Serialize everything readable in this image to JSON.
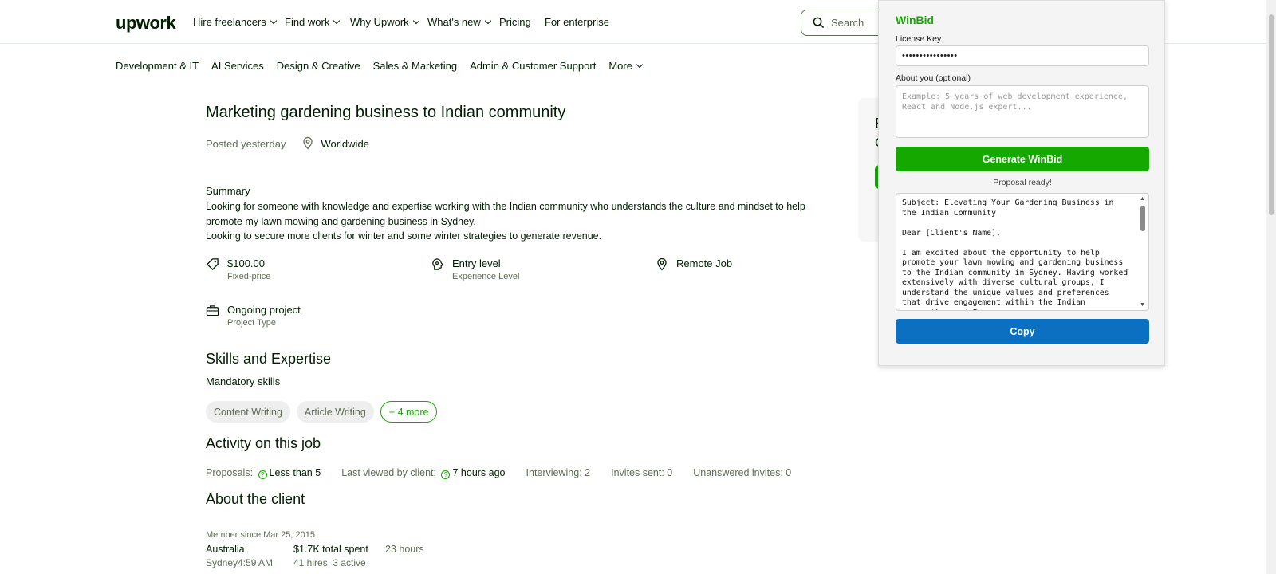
{
  "nav": {
    "logo": "upwork",
    "items": [
      "Hire freelancers",
      "Find work",
      "Why Upwork",
      "What's new",
      "Pricing",
      "For enterprise"
    ],
    "search_placeholder": "Search"
  },
  "categories": [
    "Development & IT",
    "AI Services",
    "Design & Creative",
    "Sales & Marketing",
    "Admin & Customer Support",
    "More"
  ],
  "job": {
    "title": "Marketing gardening business to Indian community",
    "posted": "Posted yesterday",
    "location": "Worldwide",
    "summary_heading": "Summary",
    "summary_lines": [
      "Looking for someone with knowledge and expertise working with the Indian community who understands the culture and mindset to help promote my lawn mowing and gardening business in Sydney.",
      "Looking to secure more clients for winter and some winter strategies to generate revenue."
    ],
    "features": [
      {
        "title": "$100.00",
        "sub": "Fixed-price",
        "icon": "tag-icon"
      },
      {
        "title": "Entry level",
        "sub": "Experience Level",
        "icon": "brain-icon"
      },
      {
        "title": "Remote Job",
        "sub": "",
        "icon": "location-pin-icon"
      },
      {
        "title": "Ongoing project",
        "sub": "Project Type",
        "icon": "briefcase-icon"
      }
    ],
    "skills_heading": "Skills and Expertise",
    "mandatory_label": "Mandatory skills",
    "skills": [
      "Content Writing",
      "Article Writing"
    ],
    "more_skills": "+ 4 more",
    "activity_heading": "Activity on this job",
    "activity": {
      "proposals_label": "Proposals:",
      "proposals_value": "Less than 5",
      "viewed_label": "Last viewed by client:",
      "viewed_value": "7 hours ago",
      "interviewing": "Interviewing: 2",
      "invites": "Invites sent: 0",
      "unanswered": "Unanswered invites: 0"
    },
    "client_heading": "About the client",
    "client": {
      "member_since": "Member since Mar 25, 2015",
      "country": "Australia",
      "city_time": "Sydney4:59 AM",
      "spent": "$1.7K total spent",
      "hires": "41 hires, 3 active",
      "hours": "23 hours"
    }
  },
  "side_card": {
    "letter1": "E",
    "letter2": "C"
  },
  "winbid": {
    "brand": "WinBid",
    "license_label": "License Key",
    "license_value": "••••••••••••••••",
    "about_label": "About you (optional)",
    "about_placeholder": "Example: 5 years of web development experience, React and Node.js expert...",
    "generate_label": "Generate WinBid",
    "status": "Proposal ready!",
    "proposal_text": "Subject: Elevating Your Gardening Business in the Indian Community\n\nDear [Client's Name],\n\nI am excited about the opportunity to help promote your lawn mowing and gardening business to the Indian community in Sydney. Having worked extensively with diverse cultural groups, I understand the unique values and preferences that drive engagement within the Indian community, and I..",
    "copy_label": "Copy",
    "colors": {
      "brand": "#14a800",
      "copy_button": "#0b6fc2"
    }
  },
  "colors": {
    "upwork_green": "#14a800",
    "text": "#001e00",
    "muted": "#5e6d55"
  }
}
